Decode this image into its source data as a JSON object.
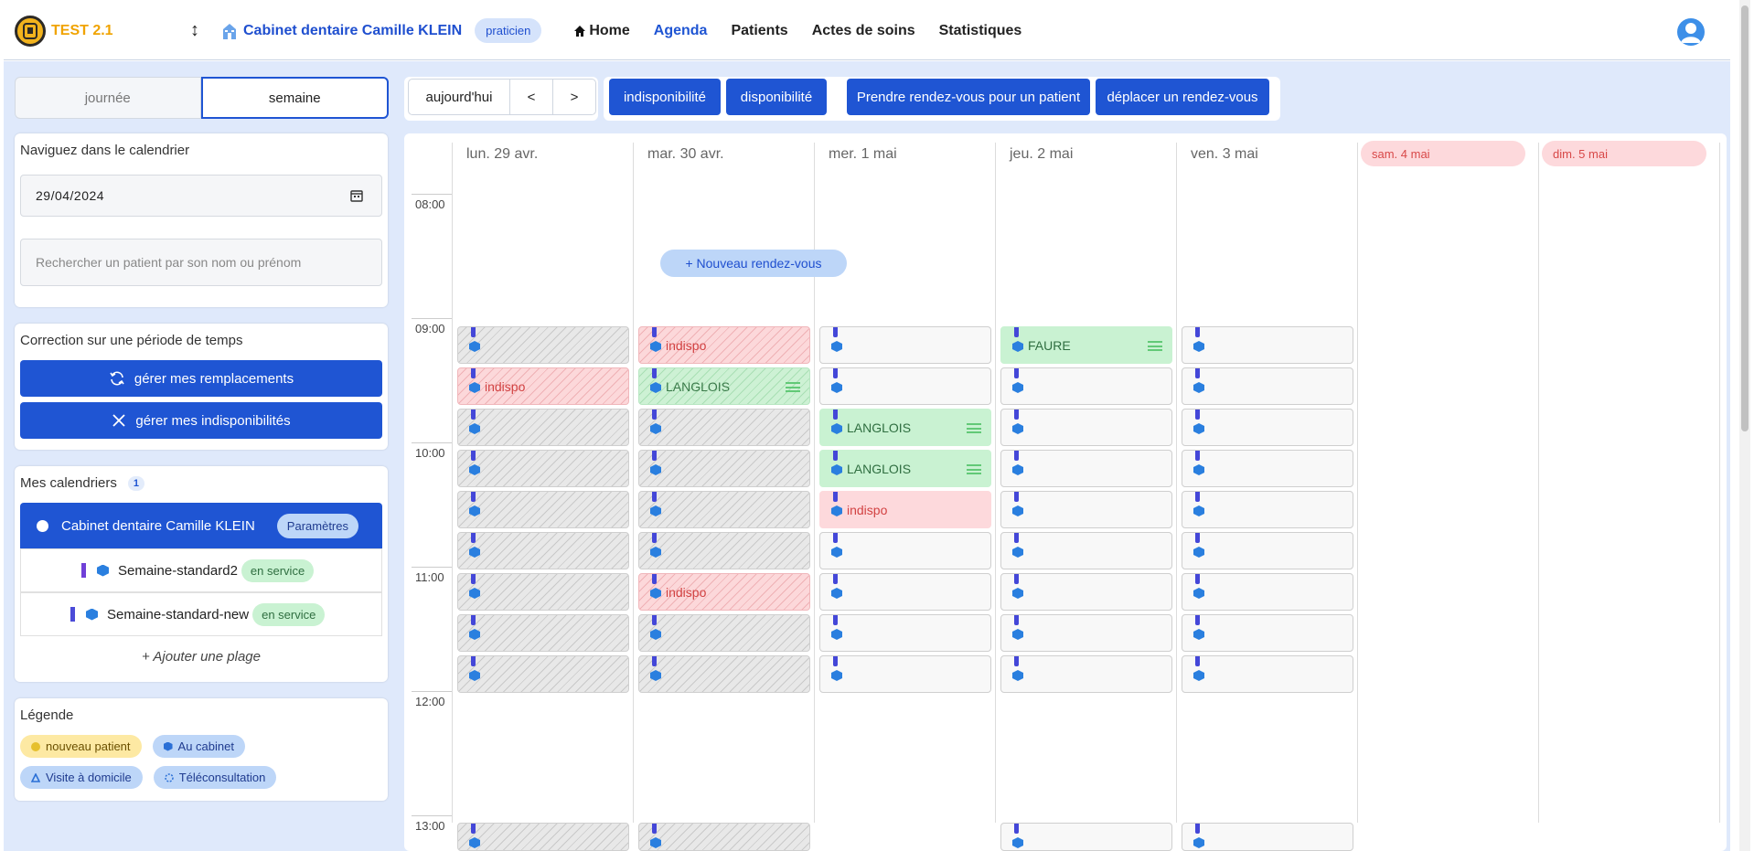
{
  "header": {
    "app_name": "TEST 2.1",
    "switch_symbol": "↕",
    "clinic_name": "Cabinet dentaire Camille KLEIN",
    "role_badge": "praticien",
    "nav": [
      "Home",
      "Agenda",
      "Patients",
      "Actes de soins",
      "Statistiques"
    ],
    "active_nav": "Agenda",
    "colors": {
      "brand": "#f0a300",
      "accent": "#1f55d3"
    }
  },
  "view_toggle": {
    "day": "journée",
    "week": "semaine",
    "selected": "semaine"
  },
  "navigation": {
    "title": "Naviguez dans le calendrier",
    "date_value": "29/04/2024",
    "search_placeholder": "Rechercher un patient par son nom ou prénom"
  },
  "correction": {
    "title": "Correction sur une période de temps",
    "replacements_button": "gérer mes remplacements",
    "unavailabilities_button": "gérer mes indisponibilités"
  },
  "calendars": {
    "title": "Mes calendriers",
    "count": "1",
    "main": {
      "name": "Cabinet dentaire Camille KLEIN",
      "settings": "Paramètres"
    },
    "items": [
      {
        "name": "Semaine-standard2",
        "status": "en service"
      },
      {
        "name": "Semaine-standard-new",
        "status": "en service"
      }
    ],
    "add_label": "+ Ajouter une plage"
  },
  "legend": {
    "title": "Légende",
    "items": [
      "nouveau patient",
      "Au cabinet",
      "Visite à domicile",
      "Téléconsultation"
    ]
  },
  "toolbar": {
    "today": "aujourd'hui",
    "prev": "<",
    "next": ">",
    "unavailability": "indisponibilité",
    "availability": "disponibilité",
    "book": "Prendre rendez-vous pour un patient",
    "move": "déplacer un rendez-vous"
  },
  "calendar": {
    "days": [
      "lun. 29 avr.",
      "mar. 30 avr.",
      "mer. 1 mai",
      "jeu. 2 mai",
      "ven. 3 mai"
    ],
    "weekend": [
      "sam. 4 mai",
      "dim. 5 mai"
    ],
    "times": [
      "08:00",
      "09:00",
      "10:00",
      "11:00",
      "12:00",
      "13:00"
    ],
    "new_appointment": "+ Nouveau rendez-vous",
    "slot_types": [
      "hatched grey = closed",
      "free",
      "indispo",
      "patient booking"
    ],
    "appointments": {
      "mon": [
        "",
        "indispo",
        "",
        "",
        "",
        "",
        "",
        "",
        ""
      ],
      "tue": [
        "indispo",
        "LANGLOIS",
        "",
        "",
        "",
        "",
        "indispo",
        "",
        ""
      ],
      "wed": [
        "",
        "",
        "LANGLOIS",
        "LANGLOIS",
        "indispo",
        "",
        "",
        "",
        ""
      ],
      "thu": [
        "FAURE",
        "",
        "",
        "",
        "",
        "",
        "",
        "",
        ""
      ],
      "fri": [
        "",
        "",
        "",
        "",
        "",
        "",
        "",
        "",
        ""
      ]
    }
  }
}
